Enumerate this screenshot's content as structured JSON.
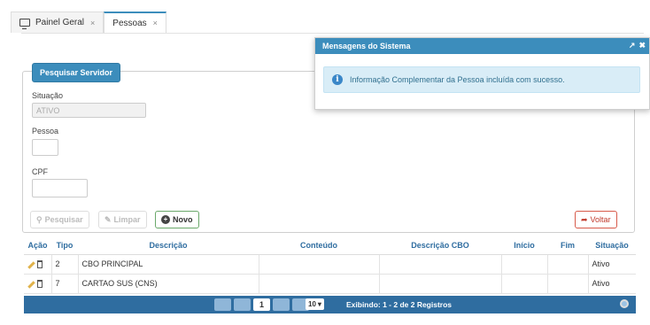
{
  "tabs": [
    {
      "label": "Painel Geral",
      "close": "×"
    },
    {
      "label": "Pessoas",
      "close": "×"
    }
  ],
  "fieldset": {
    "legend": "Pesquisar Servidor"
  },
  "form": {
    "situacao_label": "Situação",
    "situacao_value": "ATIVO",
    "pessoa_label": "Pessoa",
    "cpf_label": "CPF"
  },
  "buttons": {
    "pesquisar": "Pesquisar",
    "limpar": "Limpar",
    "novo": "Novo",
    "voltar": "Voltar"
  },
  "table": {
    "headers": [
      "Ação",
      "Tipo",
      "Descrição",
      "Conteúdo",
      "Descrição CBO",
      "Início",
      "Fim",
      "Situação"
    ],
    "rows": [
      {
        "tipo": "2",
        "descricao": "CBO PRINCIPAL",
        "conteudo": "",
        "cbo": "",
        "inicio": "",
        "fim": "",
        "situacao": "Ativo"
      },
      {
        "tipo": "7",
        "descricao": "CARTAO SUS (CNS)",
        "conteudo": "",
        "cbo": "",
        "inicio": "",
        "fim": "",
        "situacao": "Ativo"
      }
    ]
  },
  "pager": {
    "current_page": "1",
    "page_size": "10",
    "summary": "Exibindo: 1 - 2 de 2 Registros"
  },
  "messages": {
    "title": "Mensagens do Sistema",
    "text": "Informação Complementar da Pessoa incluída com sucesso."
  },
  "colors": {
    "primary": "#3c8dbc",
    "pager": "#2f6da0",
    "info_bg": "#d9edf7"
  }
}
